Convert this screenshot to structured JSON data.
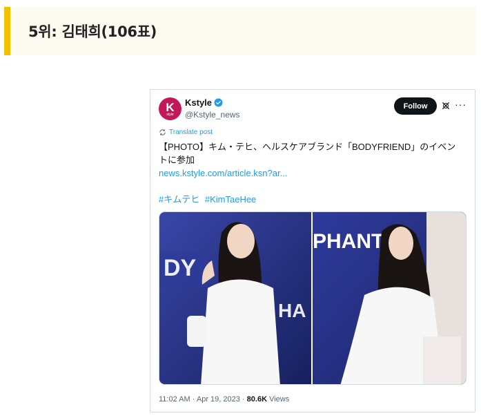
{
  "heading": "5위: 김태희(106표)",
  "tweet": {
    "avatar_text": "K",
    "avatar_sub": "style",
    "display_name": "Kstyle",
    "handle": "@Kstyle_news",
    "follow_label": "Follow",
    "more_label": "···",
    "translate_label": "Translate post",
    "body_line1": "【PHOTO】キム・テヒ、ヘルスケアブランド「BODYFRIEND」のイベン",
    "body_line2": "トに参加",
    "link": "news.kstyle.com/article.ksn?ar...",
    "hashtags": [
      "#キムテヒ",
      "#KimTaeHee"
    ],
    "time": "11:02 AM",
    "date": "Apr 19, 2023",
    "views_count": "80.6K",
    "views_label": "Views",
    "separator": "·",
    "photo_text_left": [
      "DY",
      "HA"
    ],
    "photo_text_right": "PHANT"
  },
  "colors": {
    "accent_bar": "#f2c200",
    "link_blue": "#1d9bf0",
    "avatar_bg": "#c2185b",
    "follow_bg": "#0f1419"
  }
}
